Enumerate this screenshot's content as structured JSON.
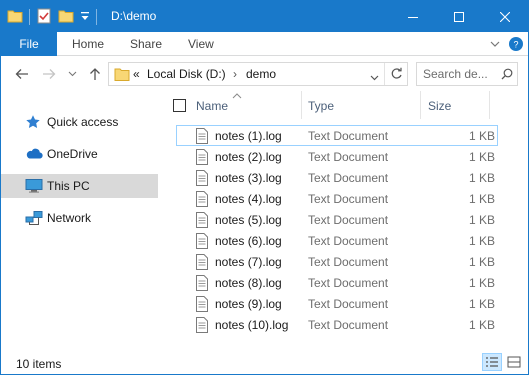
{
  "window": {
    "title": "D:\\demo",
    "accent_color": "#1979ca"
  },
  "quick_access_toolbar": {
    "icons": [
      "folder-icon",
      "properties-check-icon",
      "new-folder-icon",
      "customize-dropdown-icon"
    ]
  },
  "ribbon": {
    "tabs": [
      {
        "label": "File"
      },
      {
        "label": "Home"
      },
      {
        "label": "Share"
      },
      {
        "label": "View"
      }
    ]
  },
  "navigation": {
    "back": "back-arrow-icon",
    "forward": "forward-arrow-icon",
    "recent": "recent-locations-chevron-icon",
    "up": "up-arrow-icon"
  },
  "address_bar": {
    "overflow": "«",
    "crumbs": [
      "Local Disk (D:)",
      "demo"
    ],
    "separator": "›"
  },
  "search": {
    "placeholder": "Search de..."
  },
  "nav_pane": {
    "items": [
      {
        "label": "Quick access",
        "icon": "star-icon"
      },
      {
        "label": "OneDrive",
        "icon": "cloud-icon"
      },
      {
        "label": "This PC",
        "icon": "monitor-icon",
        "selected": true
      },
      {
        "label": "Network",
        "icon": "network-icon"
      }
    ]
  },
  "columns": {
    "name": "Name",
    "type": "Type",
    "size": "Size"
  },
  "files": [
    {
      "name": "notes (1).log",
      "type": "Text Document",
      "size": "1 KB"
    },
    {
      "name": "notes (2).log",
      "type": "Text Document",
      "size": "1 KB"
    },
    {
      "name": "notes (3).log",
      "type": "Text Document",
      "size": "1 KB"
    },
    {
      "name": "notes (4).log",
      "type": "Text Document",
      "size": "1 KB"
    },
    {
      "name": "notes (5).log",
      "type": "Text Document",
      "size": "1 KB"
    },
    {
      "name": "notes (6).log",
      "type": "Text Document",
      "size": "1 KB"
    },
    {
      "name": "notes (7).log",
      "type": "Text Document",
      "size": "1 KB"
    },
    {
      "name": "notes (8).log",
      "type": "Text Document",
      "size": "1 KB"
    },
    {
      "name": "notes (9).log",
      "type": "Text Document",
      "size": "1 KB"
    },
    {
      "name": "notes (10).log",
      "type": "Text Document",
      "size": "1 KB"
    }
  ],
  "status": {
    "item_count": "10 items"
  }
}
